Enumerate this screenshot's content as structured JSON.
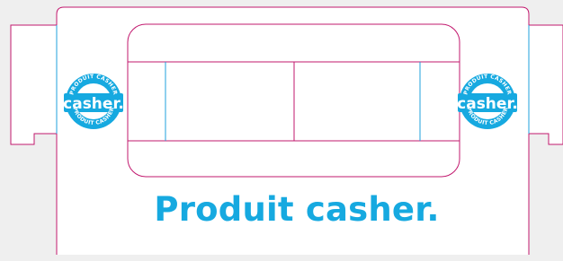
{
  "headline": "Produit casher.",
  "seal": {
    "word": "casher.",
    "ring_text": "PRODUIT CASHER"
  },
  "colors": {
    "background": "#efefef",
    "panel": "#ffffff",
    "cut_line": "#c2186e",
    "fold_line": "#1fa2dc",
    "brand": "#16a9e0"
  }
}
